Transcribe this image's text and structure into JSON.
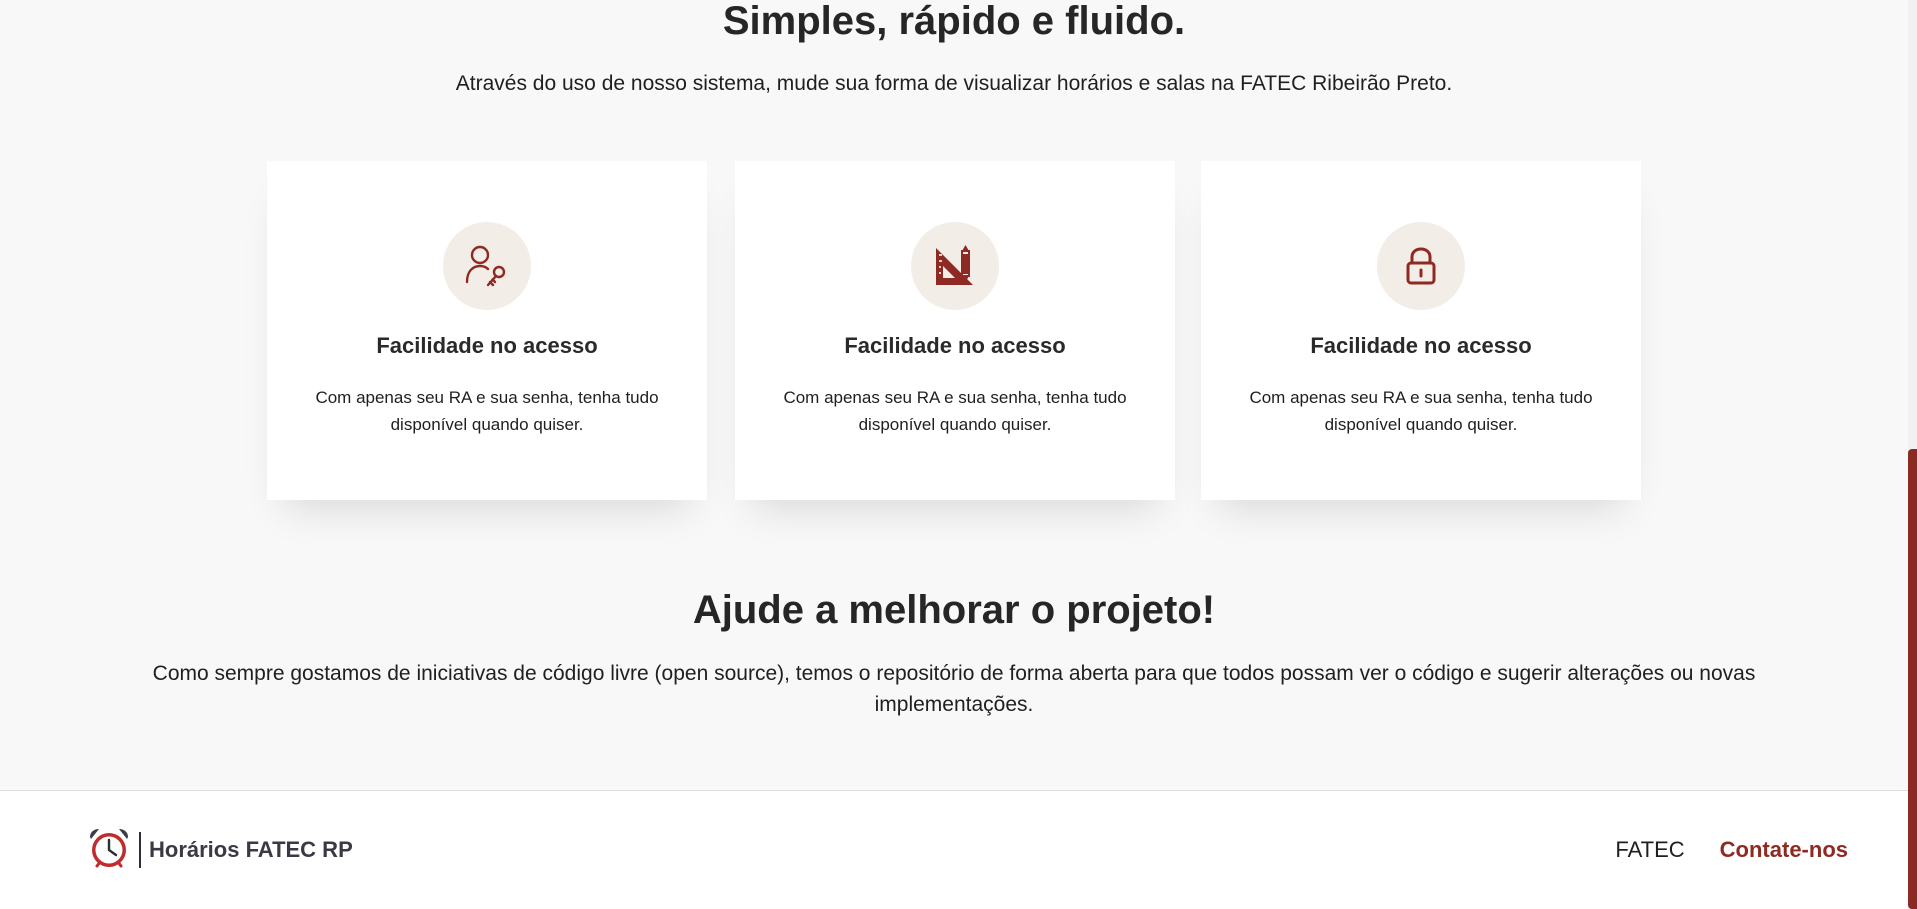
{
  "intro": {
    "title": "Simples, rápido e fluido.",
    "subtitle": "Através do uso de nosso sistema, mude sua forma de visualizar horários e salas na FATEC Ribeirão Preto."
  },
  "features": [
    {
      "icon": "user-key-icon",
      "title": "Facilidade no acesso",
      "text": "Com apenas seu RA e sua senha, tenha tudo disponível quando quiser."
    },
    {
      "icon": "ruler-pencil-icon",
      "title": "Facilidade no acesso",
      "text": "Com apenas seu RA e sua senha, tenha tudo disponível quando quiser."
    },
    {
      "icon": "padlock-icon",
      "title": "Facilidade no acesso",
      "text": "Com apenas seu RA e sua senha, tenha tudo disponível quando quiser."
    }
  ],
  "contribute": {
    "title": "Ajude a melhorar o projeto!",
    "text": "Como sempre gostamos de iniciativas de código livre (open source), temos o repositório de forma aberta para que todos possam ver o código e sugerir alterações ou novas implementações."
  },
  "footer": {
    "brand_name": "Horários FATEC RP",
    "brand_icon": "alarm-clock-icon",
    "nav": [
      {
        "label": "FATEC"
      },
      {
        "label": "Contate-nos"
      }
    ]
  },
  "colors": {
    "accent": "#8e2a23",
    "icon_bg": "#f2ede6",
    "page_bg": "#f8f8f8"
  }
}
